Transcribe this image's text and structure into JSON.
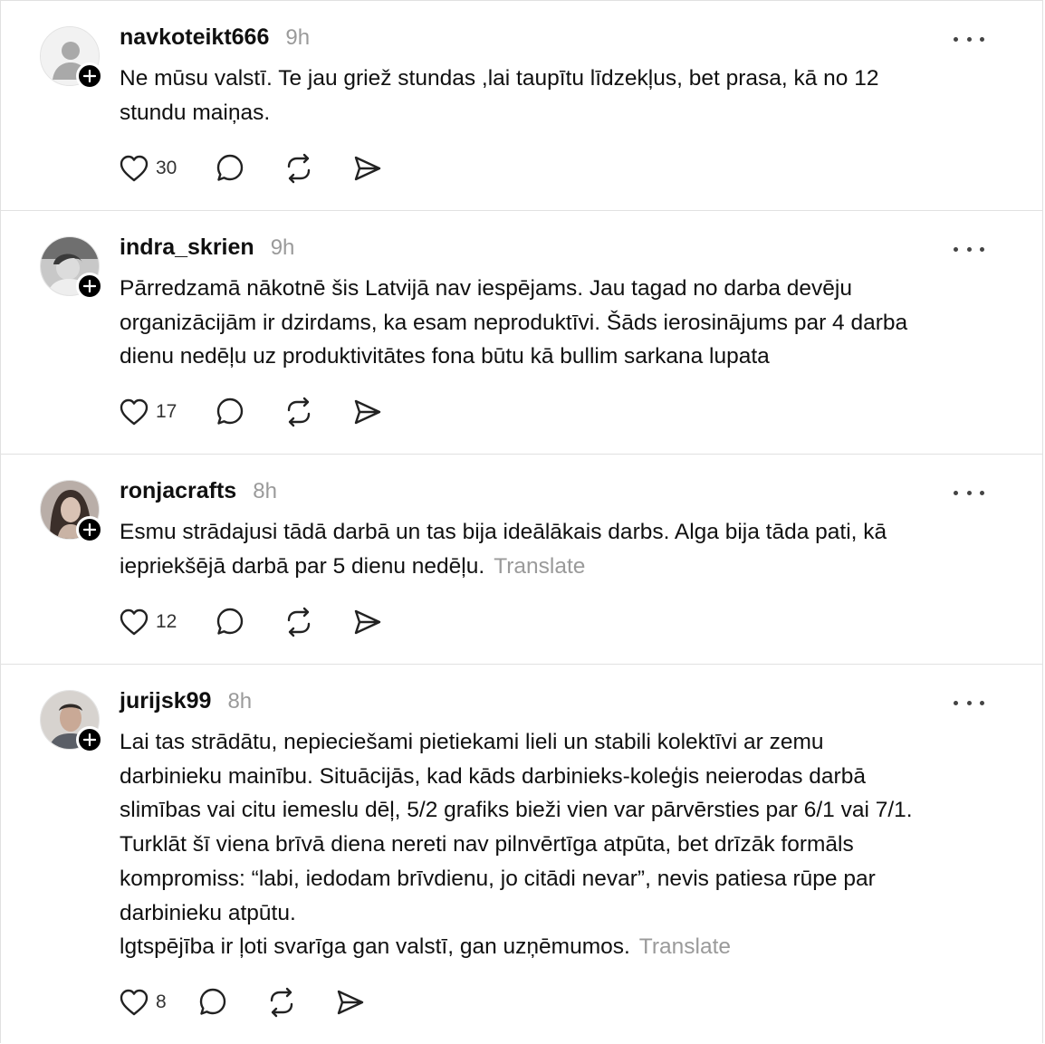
{
  "posts": [
    {
      "username": "navkoteikt666",
      "time": "9h",
      "text": "Ne mūsu valstī. Te jau griež stundas ,lai taupītu līdzekļus, bet prasa, kā no 12\nstundu maiņas.",
      "translate": "",
      "likes": "30",
      "avatar": "default-user-icon"
    },
    {
      "username": "indra_skrien",
      "time": "9h",
      "text": "Pārredzamā nākotnē šis Latvijā nav iespējams. Jau tagad no darba devēju\norganizācijām ir dzirdams, ka esam neproduktīvi. Šāds ierosinājums par 4 darba\ndienu nedēļu uz produktivitātes fona būtu kā bullim sarkana lupata",
      "translate": "",
      "likes": "17",
      "avatar": "photo"
    },
    {
      "username": "ronjacrafts",
      "time": "8h",
      "text": "Esmu strādajusi tādā darbā un tas bija ideālākais darbs. Alga bija tāda pati, kā\niepriekšējā darbā par 5 dienu nedēļu.",
      "translate": "Translate",
      "likes": "12",
      "avatar": "photo"
    },
    {
      "username": "jurijsk99",
      "time": "8h",
      "text": "Lai tas strādātu, nepieciešami pietiekami lieli un stabili kolektīvi ar zemu\ndarbinieku mainību. Situācijās, kad kāds darbinieks-koleģis neierodas darbā\nslimības vai citu iemeslu dēļ, 5/2 grafiks bieži vien var pārvērsties par 6/1 vai 7/1.\nTurklāt šī viena brīvā diena nereti nav pilnvērtīga atpūta, bet drīzāk formāls\nkompromiss: “labi, iedodam brīvdienu, jo citādi nevar”, nevis patiesa rūpe par\ndarbinieku atpūtu.\nlgtspējība ir ļoti svarīga gan valstī, gan uzņēmumos.",
      "translate": "Translate",
      "likes": "8",
      "avatar": "photo"
    }
  ],
  "icons": {
    "like": "heart-icon",
    "reply": "comment-icon",
    "repost": "repost-icon",
    "share": "send-icon",
    "more": "more-dots-icon",
    "follow": "plus-icon"
  }
}
